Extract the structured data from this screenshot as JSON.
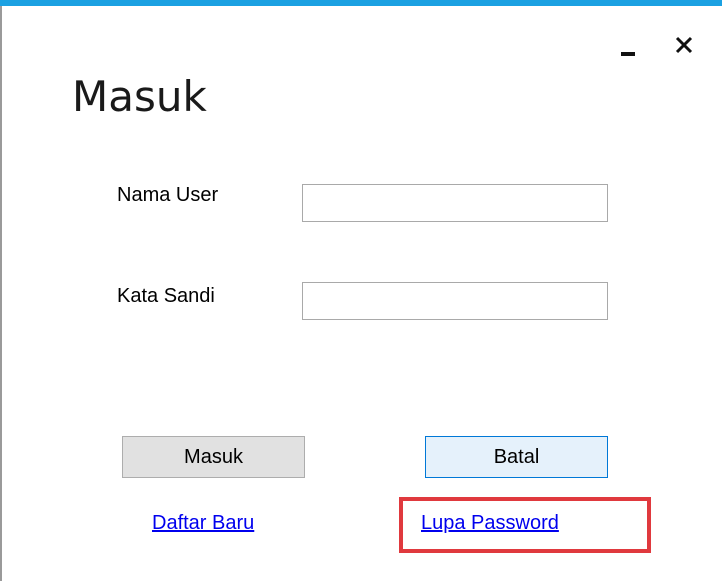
{
  "window": {
    "title": "Masuk",
    "minimize_label": "–",
    "close_label": "✕",
    "accent_color": "#1ba1e2"
  },
  "form": {
    "username_label": "Nama User",
    "username_value": "",
    "password_label": "Kata Sandi",
    "password_value": ""
  },
  "buttons": {
    "login_label": "Masuk",
    "cancel_label": "Batal"
  },
  "links": {
    "register_label": "Daftar Baru",
    "forgot_password_label": "Lupa Password"
  },
  "annotation": {
    "highlight_color": "#e0393e"
  }
}
